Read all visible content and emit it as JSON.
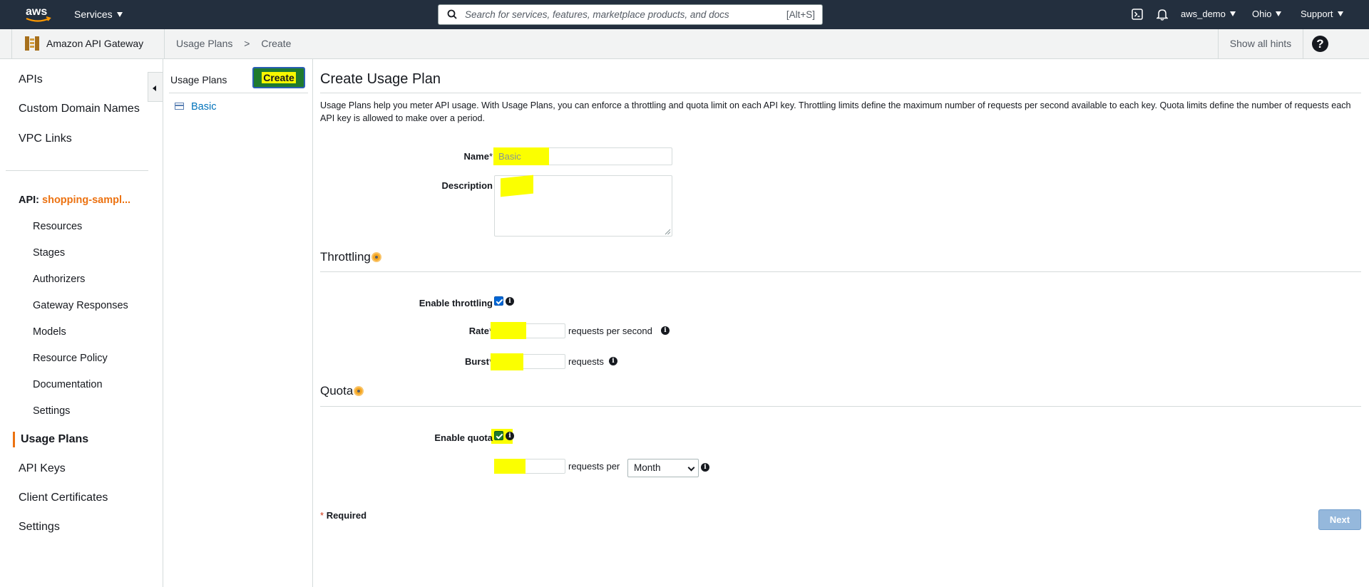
{
  "topnav": {
    "logo_text": "aws",
    "services_label": "Services",
    "search_placeholder": "Search for services, features, marketplace products, and docs",
    "search_shortcut": "[Alt+S]",
    "user": "aws_demo",
    "region": "Ohio",
    "support": "Support"
  },
  "subheader": {
    "service_name": "Amazon API Gateway",
    "breadcrumb": [
      "Usage Plans",
      ">",
      "Create"
    ],
    "hints_label": "Show all hints",
    "help_glyph": "?"
  },
  "leftnav": {
    "top_items": [
      "APIs",
      "Custom Domain Names",
      "VPC Links"
    ],
    "api_prefix": "API:",
    "api_name": "shopping-sampl...",
    "api_items": [
      "Resources",
      "Stages",
      "Authorizers",
      "Gateway Responses",
      "Models",
      "Resource Policy",
      "Documentation",
      "Settings"
    ],
    "bottom_items": [
      "Usage Plans",
      "API Keys",
      "Client Certificates",
      "Settings"
    ],
    "active_item": "Usage Plans"
  },
  "midpanel": {
    "title": "Usage Plans",
    "create_label": "Create",
    "plans": [
      "Basic"
    ]
  },
  "form": {
    "title": "Create Usage Plan",
    "intro": "Usage Plans help you meter API usage. With Usage Plans, you can enforce a throttling and quota limit on each API key. Throttling limits define the maximum number of requests per second available to each key. Quota limits define the number of requests each API key is allowed to make over a period.",
    "name_label": "Name",
    "name_value": "Basic",
    "description_label": "Description",
    "description_value": "",
    "required_star": "*",
    "throttling_title": "Throttling",
    "enable_throttling_label": "Enable throttling",
    "enable_throttling_checked": true,
    "rate_label": "Rate",
    "rate_value": "",
    "rate_unit": "requests per second",
    "burst_label": "Burst",
    "burst_value": "",
    "burst_unit": "requests",
    "quota_title": "Quota",
    "enable_quota_label": "Enable quota",
    "enable_quota_checked": true,
    "quota_value": "",
    "quota_unit": "requests per",
    "quota_period": "Month",
    "required_note": "Required",
    "next_label": "Next"
  },
  "colors": {
    "nav_bg": "#232f3e",
    "accent_orange": "#ec7211",
    "link_blue": "#0073bb",
    "highlight_yellow": "#fbff00"
  }
}
